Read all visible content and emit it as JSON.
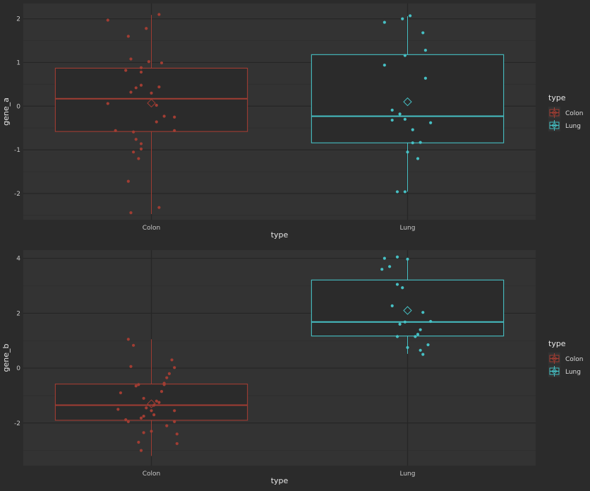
{
  "colors": {
    "background": "#2b2b2b",
    "panel": "#333333",
    "grid_major": "#262626",
    "grid_minor": "#2f2f2f",
    "colon": "#a13d33",
    "lung": "#46c0c4"
  },
  "chart_data": [
    {
      "type": "boxplot",
      "xlabel": "type",
      "ylabel": "gene_a",
      "categories": [
        "Colon",
        "Lung"
      ],
      "ylim": [
        -2.6,
        2.35
      ],
      "yticks": [
        -2,
        -1,
        0,
        1,
        2
      ],
      "grid": true,
      "legend": {
        "title": "type",
        "position": "right",
        "entries": [
          "Colon",
          "Lung"
        ]
      },
      "boxes": [
        {
          "name": "Colon",
          "q1": -0.58,
          "median": 0.17,
          "q3": 0.87,
          "whisker_low": -2.47,
          "whisker_high": 2.09,
          "mean": 0.07
        },
        {
          "name": "Lung",
          "q1": -0.84,
          "median": -0.23,
          "q3": 1.18,
          "whisker_low": -1.96,
          "whisker_high": 2.06,
          "mean": 0.1
        }
      ],
      "points": [
        {
          "group": "Colon",
          "x": [
            -0.17,
            0.03,
            -0.02,
            -0.09,
            -0.08,
            -0.04,
            -0.1,
            -0.04,
            -0.01,
            0.04,
            -0.06,
            -0.08,
            -0.04,
            0.03,
            0.0,
            0.02,
            0.05,
            0.09,
            -0.17,
            -0.14,
            0.02,
            -0.07,
            0.09,
            -0.06,
            -0.04,
            -0.04,
            -0.07,
            -0.09,
            -0.08,
            0.03,
            -0.05
          ],
          "y": [
            1.97,
            2.1,
            1.78,
            1.6,
            1.08,
            0.88,
            0.82,
            0.78,
            1.02,
            0.99,
            0.42,
            0.32,
            0.48,
            0.44,
            0.3,
            0.02,
            -0.23,
            -0.25,
            0.06,
            -0.56,
            -0.36,
            -0.59,
            -0.56,
            -0.76,
            -0.86,
            -0.98,
            -1.05,
            -1.72,
            -2.44,
            -2.32,
            -1.2
          ]
        },
        {
          "group": "Lung",
          "x": [
            -0.09,
            -0.02,
            0.01,
            0.06,
            0.07,
            -0.01,
            -0.09,
            0.07,
            -0.06,
            0.02,
            0.09,
            -0.03,
            -0.01,
            -0.06,
            0.05,
            0.02,
            0.0,
            0.04,
            -0.01,
            -0.04
          ],
          "y": [
            1.92,
            2.0,
            2.07,
            1.68,
            1.28,
            1.16,
            0.94,
            0.64,
            -0.32,
            -0.54,
            -0.38,
            -0.18,
            -0.3,
            -0.09,
            -0.83,
            -0.84,
            -1.05,
            -1.2,
            -1.96,
            -1.96
          ]
        }
      ]
    },
    {
      "type": "boxplot",
      "xlabel": "type",
      "ylabel": "gene_b",
      "categories": [
        "Colon",
        "Lung"
      ],
      "ylim": [
        -3.55,
        4.3
      ],
      "yticks": [
        -2,
        0,
        2,
        4
      ],
      "grid": true,
      "legend": {
        "title": "type",
        "position": "right",
        "entries": [
          "Colon",
          "Lung"
        ]
      },
      "boxes": [
        {
          "name": "Colon",
          "q1": -1.9,
          "median": -1.35,
          "q3": -0.58,
          "whisker_low": -3.2,
          "whisker_high": 1.05,
          "mean": -1.3
        },
        {
          "name": "Lung",
          "q1": 1.17,
          "median": 1.68,
          "q3": 3.21,
          "whisker_low": 0.52,
          "whisker_high": 4.0,
          "mean": 2.1
        }
      ],
      "points": [
        {
          "group": "Colon",
          "x": [
            -0.09,
            -0.07,
            -0.08,
            -0.05,
            -0.06,
            -0.03,
            0.08,
            0.09,
            0.07,
            0.06,
            0.05,
            0.05,
            0.04,
            0.02,
            0.03,
            0.01,
            -0.02,
            0.0,
            0.01,
            -0.03,
            -0.04,
            -0.1,
            -0.12,
            -0.13,
            -0.09,
            0.0,
            -0.03,
            -0.05,
            -0.04,
            0.09,
            0.06,
            0.1,
            0.1,
            0.09
          ],
          "y": [
            1.05,
            0.83,
            0.06,
            -0.6,
            -0.65,
            -1.1,
            0.3,
            0.02,
            -0.2,
            -0.35,
            -0.55,
            -0.6,
            -0.85,
            -1.2,
            -1.25,
            -1.35,
            -1.45,
            -1.55,
            -1.7,
            -1.75,
            -1.82,
            -1.88,
            -0.9,
            -1.5,
            -1.95,
            -2.3,
            -2.35,
            -2.7,
            -3.0,
            -1.55,
            -2.1,
            -2.4,
            -2.75,
            -1.95
          ]
        },
        {
          "group": "Lung",
          "x": [
            -0.09,
            -0.04,
            0.0,
            -0.1,
            -0.07,
            -0.04,
            -0.02,
            -0.06,
            0.06,
            0.09,
            -0.03,
            0.05,
            0.04,
            0.03,
            -0.04,
            0.0,
            0.05,
            0.06,
            0.08,
            -0.01
          ],
          "y": [
            4.0,
            4.05,
            3.97,
            3.6,
            3.7,
            3.05,
            2.93,
            2.27,
            2.03,
            1.7,
            1.6,
            1.4,
            1.23,
            1.15,
            1.15,
            0.75,
            0.65,
            0.5,
            0.85,
            1.68
          ]
        }
      ]
    }
  ]
}
